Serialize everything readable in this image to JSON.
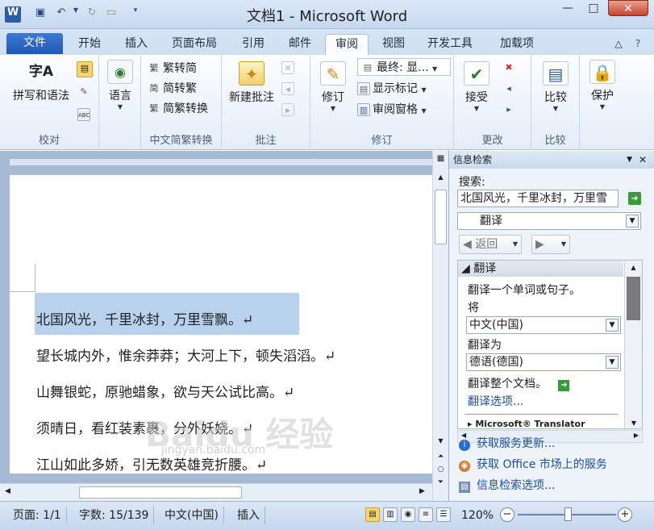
{
  "title": "文档1 - Microsoft Word",
  "qat": {
    "word_icon": "W",
    "undo_icon": "undo-icon",
    "redo_icon": "redo-icon"
  },
  "tabs": [
    "文件",
    "开始",
    "插入",
    "页面布局",
    "引用",
    "邮件",
    "审阅",
    "视图",
    "开发工具",
    "加载项"
  ],
  "ribbon": {
    "proofing": {
      "spell": "拼写和语法",
      "label": "校对"
    },
    "language": {
      "label": "语言"
    },
    "chinese": {
      "t2s": "繁转简",
      "s2t": "简转繁",
      "conv": "简繁转换",
      "label": "中文简繁转换"
    },
    "comments": {
      "new": "新建批注",
      "label": "批注"
    },
    "tracking": {
      "track": "修订",
      "final": "最终: 显...",
      "markup": "显示标记",
      "pane": "审阅窗格",
      "label": "修订"
    },
    "changes": {
      "accept": "接受",
      "label": "更改"
    },
    "compare": {
      "compare": "比较",
      "label": "比较"
    },
    "protect": {
      "protect": "保护"
    }
  },
  "document": {
    "lines": [
      "北国风光，千里冰封，万里雪飘。↵",
      "望长城内外，惟余莽莽；大河上下，顿失滔滔。↵",
      "山舞银蛇，原驰蜡象，欲与天公试比高。↵",
      "须晴日，看红装素裹，分外妖娆。↵",
      "江山如此多娇，引无数英雄竞折腰。↵"
    ]
  },
  "pane": {
    "title": "信息检索",
    "search_label": "搜索:",
    "search_value": "北国风光，千里冰封，万里雪",
    "service": "翻译",
    "back": "返回",
    "section": "翻译",
    "desc": "翻译一个单词或句子。",
    "from_label": "将",
    "from_value": "中文(中国)",
    "to_label": "翻译为",
    "to_value": "德语(德国)",
    "whole_doc": "翻译整个文档。",
    "options": "翻译选项...",
    "cut_text": "▸ Microsoft® Translator",
    "links": [
      "获取服务更新...",
      "获取 Office 市场上的服务",
      "信息检索选项..."
    ]
  },
  "status": {
    "page": "页面: 1/1",
    "words": "字数: 15/139",
    "lang": "中文(中国)",
    "mode": "插入",
    "zoom": "120%"
  },
  "watermark": {
    "text": "Baidu 经验",
    "sub": "jingyan.baidu.com"
  }
}
